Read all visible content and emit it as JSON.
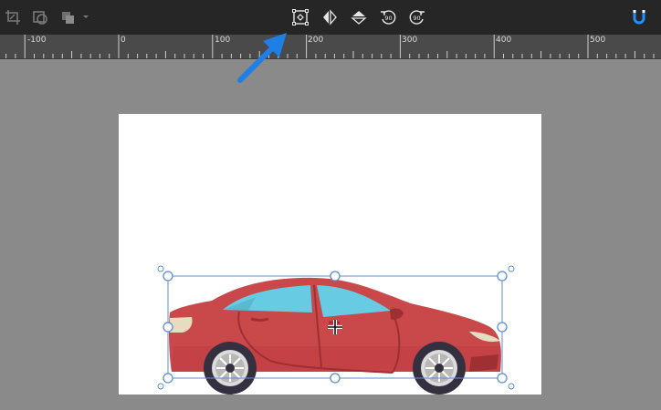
{
  "toolbar": {
    "left_tools": [
      {
        "name": "crop-tool",
        "icon": "crop-icon"
      },
      {
        "name": "mask-tool",
        "icon": "mask-icon"
      },
      {
        "name": "arrange-dropdown",
        "icon": "layers-icon"
      }
    ],
    "center_tools": [
      {
        "name": "transform-tool",
        "icon": "transform-box-icon",
        "highlighted": true
      },
      {
        "name": "flip-horizontal",
        "icon": "flip-horizontal-icon"
      },
      {
        "name": "flip-vertical",
        "icon": "flip-vertical-icon"
      },
      {
        "name": "rotate-left-90",
        "icon": "rotate-left-icon",
        "label": "90"
      },
      {
        "name": "rotate-right-90",
        "icon": "rotate-right-icon",
        "label": "90"
      }
    ],
    "right_tools": [
      {
        "name": "snap-magnet",
        "icon": "magnet-icon",
        "color": "#1e90ff"
      }
    ]
  },
  "ruler": {
    "labels": [
      "-100",
      "0",
      "100",
      "200",
      "300",
      "400",
      "500"
    ]
  },
  "colors": {
    "toolbar_bg": "#262626",
    "workspace_bg": "#8a8a8a",
    "selection": "#5b8fd6",
    "arrow": "#1e7fe6",
    "car_body": "#c9484a",
    "car_window": "#67cbe3"
  }
}
